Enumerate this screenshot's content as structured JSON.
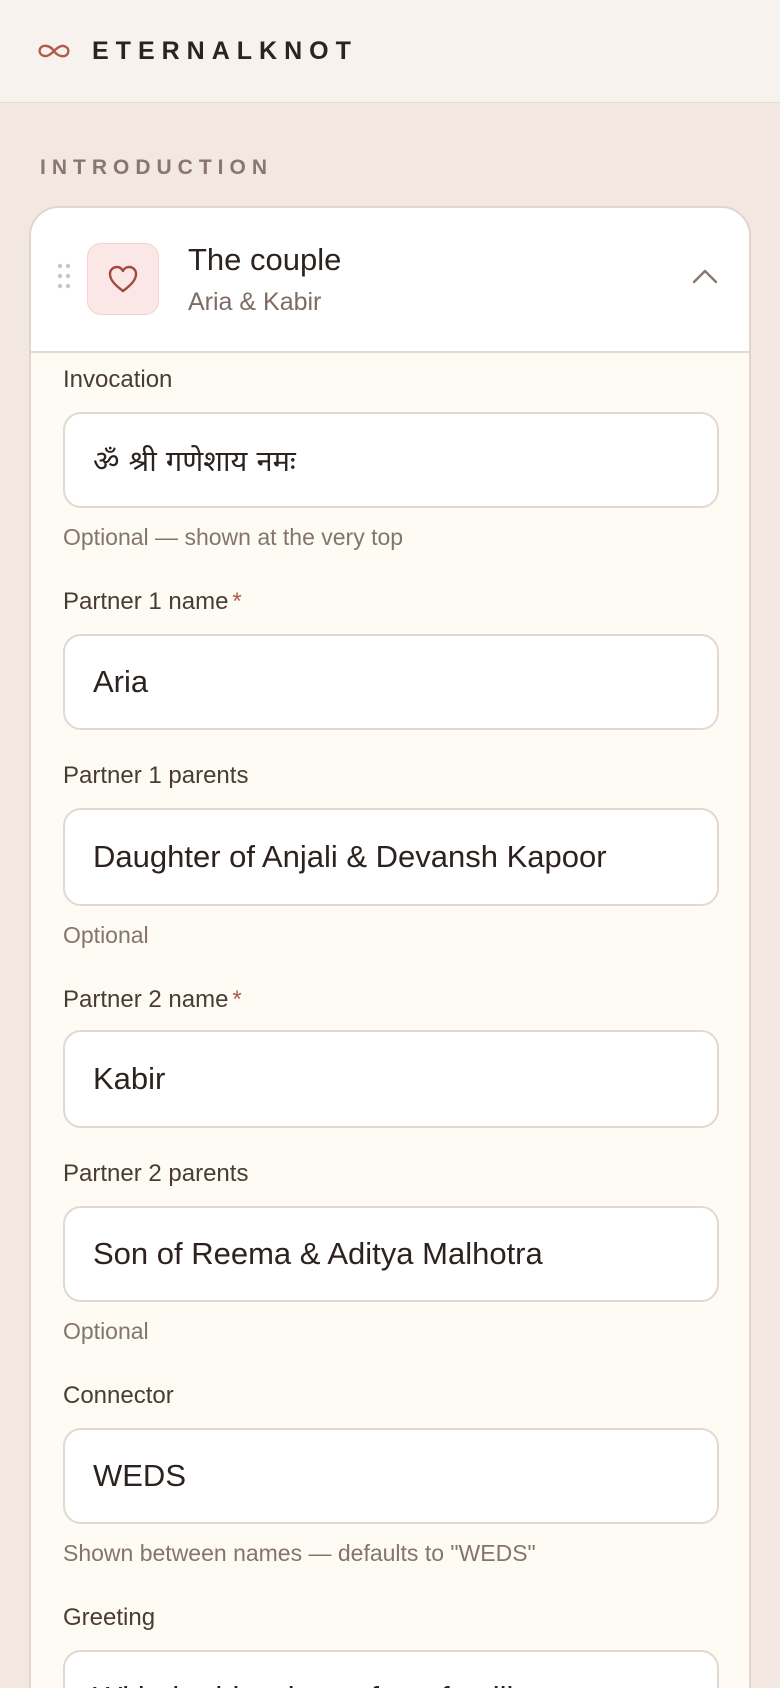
{
  "brand": {
    "name": "ETERNALKNOT",
    "icon": "infinity-icon",
    "accent": "#b15a4e"
  },
  "section": {
    "label": "INTRODUCTION"
  },
  "card": {
    "icon": "heart-icon",
    "title": "The couple",
    "subtitle": "Aria & Kabir",
    "collapse_icon": "chevron-up-icon"
  },
  "fields": {
    "invocation": {
      "label": "Invocation",
      "value": "ॐ श्री गणेशाय नमः",
      "help": "Optional — shown at the very top"
    },
    "partner1_name": {
      "label": "Partner 1 name",
      "required": "*",
      "value": "Aria"
    },
    "partner1_parents": {
      "label": "Partner 1 parents",
      "value": "Daughter of Anjali & Devansh Kapoor",
      "help": "Optional"
    },
    "partner2_name": {
      "label": "Partner 2 name",
      "required": "*",
      "value": "Kabir"
    },
    "partner2_parents": {
      "label": "Partner 2 parents",
      "value": "Son of Reema & Aditya Malhotra",
      "help": "Optional"
    },
    "connector": {
      "label": "Connector",
      "value": "WEDS",
      "help": "Shown between names — defaults to \"WEDS\""
    },
    "greeting": {
      "label": "Greeting",
      "value": "With the blessings of our families"
    }
  }
}
